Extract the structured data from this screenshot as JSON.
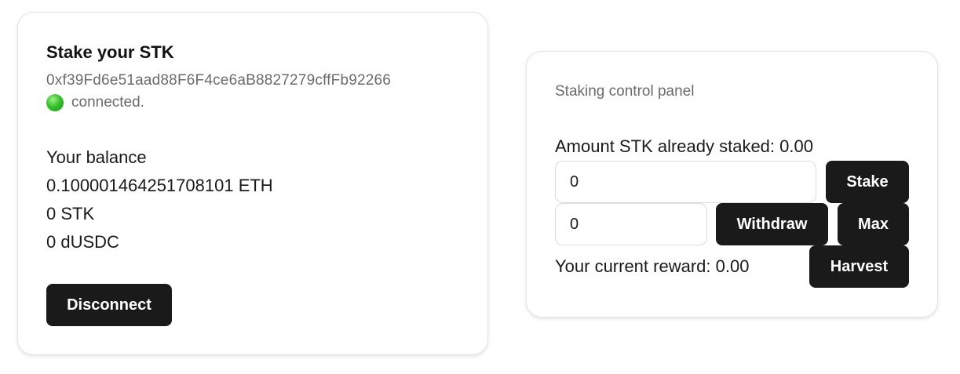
{
  "wallet": {
    "title": "Stake your STK",
    "address": "0xf39Fd6e51aad88F6F4ce6aB8827279cffFb92266",
    "status": "connected.",
    "status_color": "#36c22a",
    "balance_label": "Your balance",
    "balances": {
      "eth": "0.100001464251708101 ETH",
      "stk": "0 STK",
      "dusdc": "0 dUSDC"
    },
    "disconnect_label": "Disconnect"
  },
  "panel": {
    "title": "Staking control panel",
    "staked_text": "Amount STK already staked: 0.00",
    "stake_input_value": "0",
    "stake_label": "Stake",
    "withdraw_input_value": "0",
    "withdraw_label": "Withdraw",
    "max_label": "Max",
    "reward_text": "Your current reward: 0.00",
    "harvest_label": "Harvest"
  },
  "colors": {
    "button_bg": "#1a1a1a",
    "button_text": "#ffffff",
    "muted_text": "#6b6b6b"
  }
}
